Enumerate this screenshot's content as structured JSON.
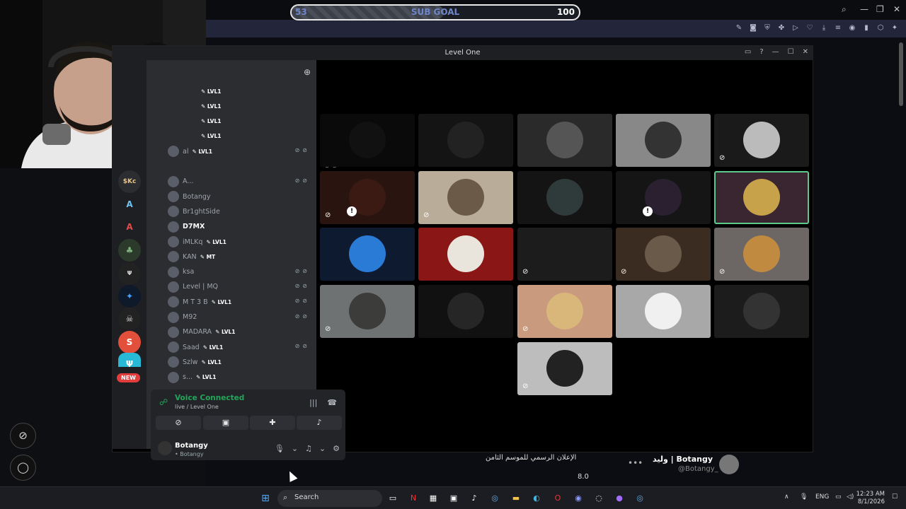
{
  "goal": {
    "current": "53",
    "label": "SUB GOAL",
    "max": "100",
    "progress": 0.53
  },
  "window": {
    "title": "Level One"
  },
  "members": [
    {
      "name": "",
      "tag": "LVL1"
    },
    {
      "name": "",
      "tag": "LVL1"
    },
    {
      "name": "",
      "tag": "LVL1"
    },
    {
      "name": "",
      "tag": "LVL1"
    },
    {
      "name": "al",
      "tag": "LVL1"
    },
    {
      "name": "",
      "tag": ""
    },
    {
      "name": "A...",
      "tag": ""
    },
    {
      "name": "Botangy",
      "tag": ""
    },
    {
      "name": "Br1ghtSide",
      "tag": ""
    },
    {
      "name": "D7MX",
      "tag": ""
    },
    {
      "name": "iMLKq",
      "tag": "LVL1"
    },
    {
      "name": "KAN",
      "tag": "MT"
    },
    {
      "name": "ksa",
      "tag": ""
    },
    {
      "name": "Level | MQ",
      "tag": ""
    },
    {
      "name": "M T 3 B",
      "tag": "LVL1"
    },
    {
      "name": "M92",
      "tag": ""
    },
    {
      "name": "MADARA",
      "tag": "LVL1"
    },
    {
      "name": "Saad",
      "tag": "LVL1"
    },
    {
      "name": "Szlw",
      "tag": "LVL1"
    },
    {
      "name": "s...",
      "tag": "LVL1"
    }
  ],
  "voice": {
    "status": "Voice Connected",
    "channel": "live / Level One",
    "buttons": [
      "camera-off",
      "screen-share",
      "activities",
      "soundboard"
    ]
  },
  "user": {
    "name": "Botangy",
    "status": "• Botangy"
  },
  "guild_badge": "NEW",
  "tweet": {
    "text": "الإعلان الرسمي للموسم الثامن",
    "number": "8.0",
    "author": "وليد | Botangy",
    "handle": "@Botangy_"
  },
  "taskbar": {
    "search": "Search",
    "lang": "ENG",
    "time": "12:23 AM",
    "date": "8/1/2026"
  },
  "colors": {
    "accent": "#23a55a",
    "speaking": "#5dc98a",
    "goal_text": "#6f86c9"
  },
  "icons": [
    "search-icon",
    "mute-icon",
    "deafen-icon",
    "settings-icon",
    "hangup-icon",
    "signal-icon",
    "add-friend-icon"
  ]
}
